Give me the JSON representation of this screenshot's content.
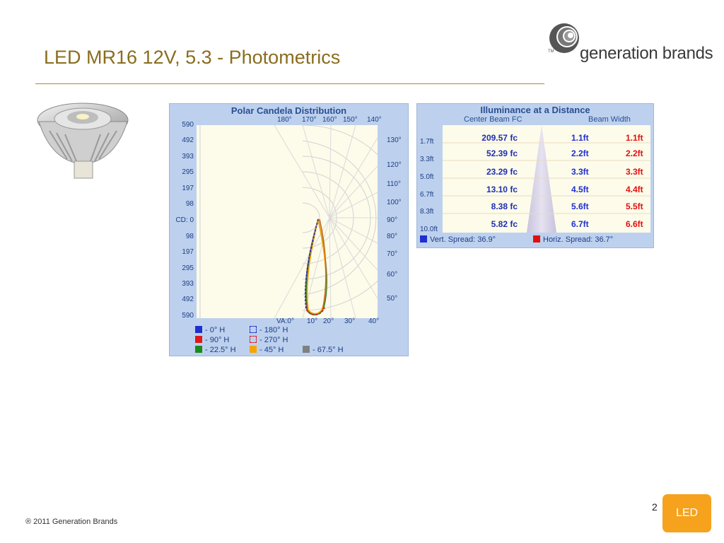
{
  "slide": {
    "title": "LED MR16 12V, 5.3 - Photometrics",
    "logo_text": "generation brands",
    "logo_tm": "TM",
    "footer": "® 2011 Generation Brands",
    "page_number": "2",
    "badge": "LED",
    "badge_color": "#f6a21d",
    "accent_color": "#8a6d1f"
  },
  "polar": {
    "title": "Polar Candela Distribution",
    "y_labels": [
      "590",
      "492",
      "393",
      "295",
      "197",
      "98",
      "CD: 0",
      "98",
      "197",
      "295",
      "393",
      "492",
      "590"
    ],
    "top_angles": [
      "180°",
      "170°",
      "160°",
      "150°",
      "140°"
    ],
    "right_angles": [
      "130°",
      "120°",
      "110°",
      "100°",
      "90°",
      "80°",
      "70°",
      "60°",
      "50°"
    ],
    "bottom_angles": [
      "VA:0°",
      "10°",
      "20°",
      "30°",
      "40°"
    ],
    "legend": [
      {
        "label": "- 0° H",
        "color": "#1e2fd0",
        "style": "solid"
      },
      {
        "label": "- 180° H",
        "color": "#1e2fd0",
        "style": "dashed"
      },
      {
        "label": "- 90° H",
        "color": "#e01818",
        "style": "solid"
      },
      {
        "label": "- 270° H",
        "color": "#e01818",
        "style": "dashed"
      },
      {
        "label": "- 22.5° H",
        "color": "#1a8a1a",
        "style": "solid"
      },
      {
        "label": "- 45° H",
        "color": "#f5a500",
        "style": "solid"
      },
      {
        "label": "- 67.5° H",
        "color": "#808080",
        "style": "solid"
      }
    ]
  },
  "illuminance": {
    "title": "Illuminance at a Distance",
    "col_center": "Center Beam FC",
    "col_width": "Beam Width",
    "rows": [
      {
        "distance": "1.7ft",
        "fc": "209.57 fc",
        "vert": "1.1ft",
        "horiz": "1.1ft"
      },
      {
        "distance": "3.3ft",
        "fc": "52.39 fc",
        "vert": "2.2ft",
        "horiz": "2.2ft"
      },
      {
        "distance": "5.0ft",
        "fc": "23.29 fc",
        "vert": "3.3ft",
        "horiz": "3.3ft"
      },
      {
        "distance": "6.7ft",
        "fc": "13.10 fc",
        "vert": "4.5ft",
        "horiz": "4.4ft"
      },
      {
        "distance": "8.3ft",
        "fc": "8.38 fc",
        "vert": "5.6ft",
        "horiz": "5.5ft"
      },
      {
        "distance": "10.0ft",
        "fc": "5.82 fc",
        "vert": "6.7ft",
        "horiz": "6.6ft"
      }
    ],
    "vert_spread": "Vert. Spread: 36.9°",
    "horiz_spread": "Horiz. Spread: 36.7°",
    "vert_color": "#1e2fd0",
    "horiz_color": "#e01010"
  }
}
